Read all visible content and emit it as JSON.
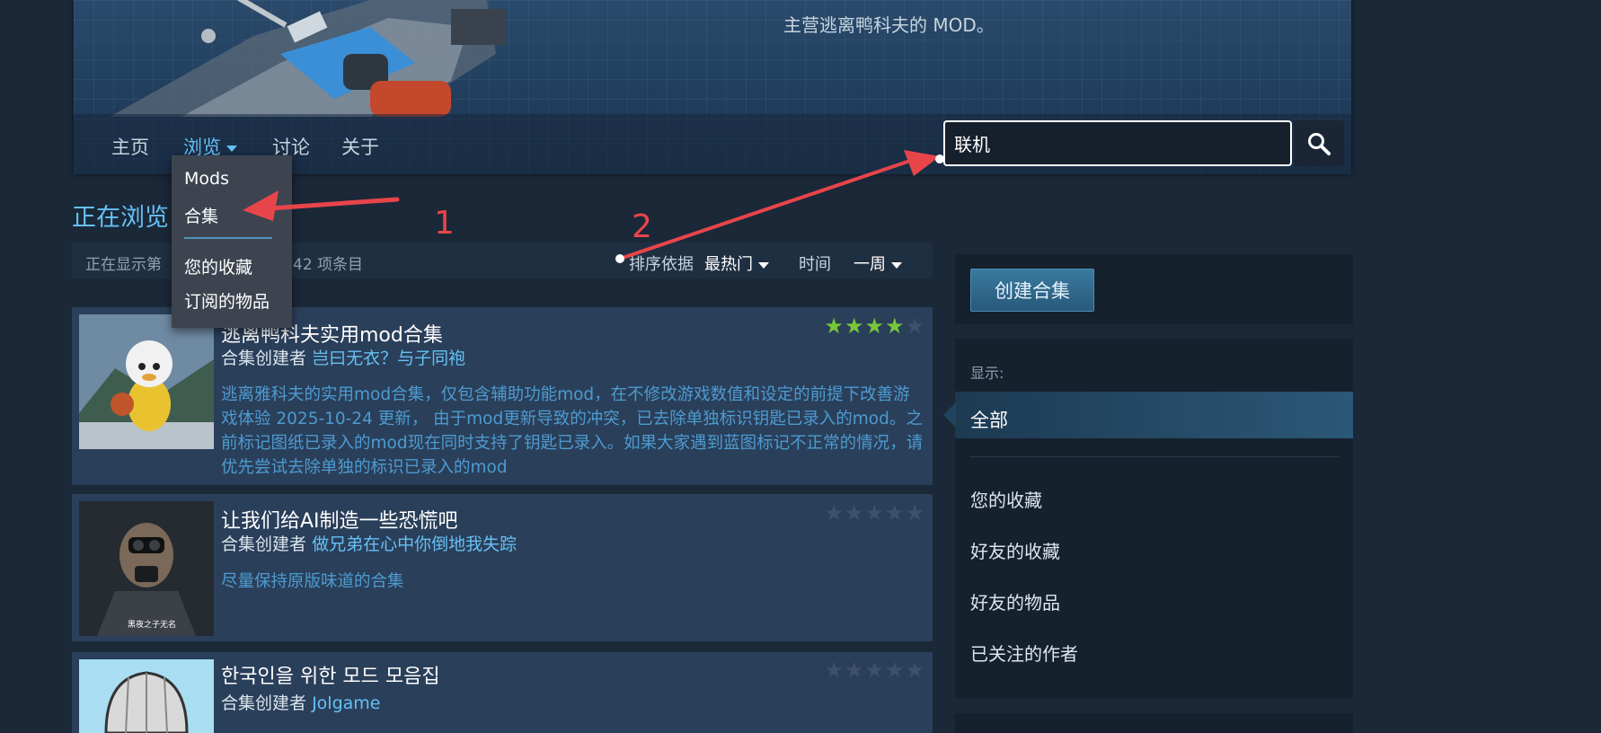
{
  "header": {
    "subtitle": "主营逃离鸭科夫的 MOD。",
    "nav": [
      {
        "label": "主页"
      },
      {
        "label": "浏览"
      },
      {
        "label": "讨论"
      },
      {
        "label": "关于"
      }
    ],
    "search": {
      "value": "联机"
    }
  },
  "dropdown": {
    "items": [
      {
        "label": "Mods"
      },
      {
        "label": "合集"
      },
      {
        "label": "您的收藏"
      },
      {
        "label": "订阅的物品"
      }
    ]
  },
  "browse": {
    "title": "正在浏览",
    "showing_prefix": "正在显示第",
    "showing_suffix": "42 项条目",
    "sort_label": "排序依据",
    "sort_value": "最热门",
    "time_label": "时间",
    "time_value": "一周"
  },
  "items": [
    {
      "title": "逃离鸭科夫实用mod合集",
      "by_label": "合集创建者",
      "author": "岂曰无衣？与子同袍",
      "description": "逃离雅科夫的实用mod合集，仅包含辅助功能mod，在不修改游戏数值和设定的前提下改善游戏体验 2025-10-24 更新， 由于mod更新导致的冲突，已去除单独标识钥匙已录入的mod。之前标记图纸已录入的mod现在同时支持了钥匙已录入。如果大家遇到蓝图标记不正常的情况，请优先尝试去除单独的标识已录入的mod",
      "rating": 4
    },
    {
      "title": "让我们给AI制造一些恐慌吧",
      "by_label": "合集创建者",
      "author": "做兄弟在心中你倒地我失踪",
      "description": "尽量保持原版味道的合集",
      "thumb_caption": "黑夜之子无名",
      "rating": 0
    },
    {
      "title": "한국인을 위한 모드 모음집",
      "by_label": "合集创建者",
      "author": "Jolgame",
      "rating": 0
    }
  ],
  "sidebar": {
    "create_label": "创建合集",
    "show_label": "显示:",
    "filters": [
      {
        "label": "全部"
      },
      {
        "label": "您的收藏"
      },
      {
        "label": "好友的收藏"
      },
      {
        "label": "好友的物品"
      },
      {
        "label": "已关注的作者"
      }
    ]
  },
  "annotations": [
    "1",
    "2"
  ],
  "icons": {
    "search": "search-icon",
    "caret": "chevron-down-icon",
    "star": "star-icon"
  },
  "colors": {
    "accent": "#66c0f4",
    "background": "#1b2838",
    "annotation": "#e8454a",
    "star_on": "#78c63b"
  }
}
